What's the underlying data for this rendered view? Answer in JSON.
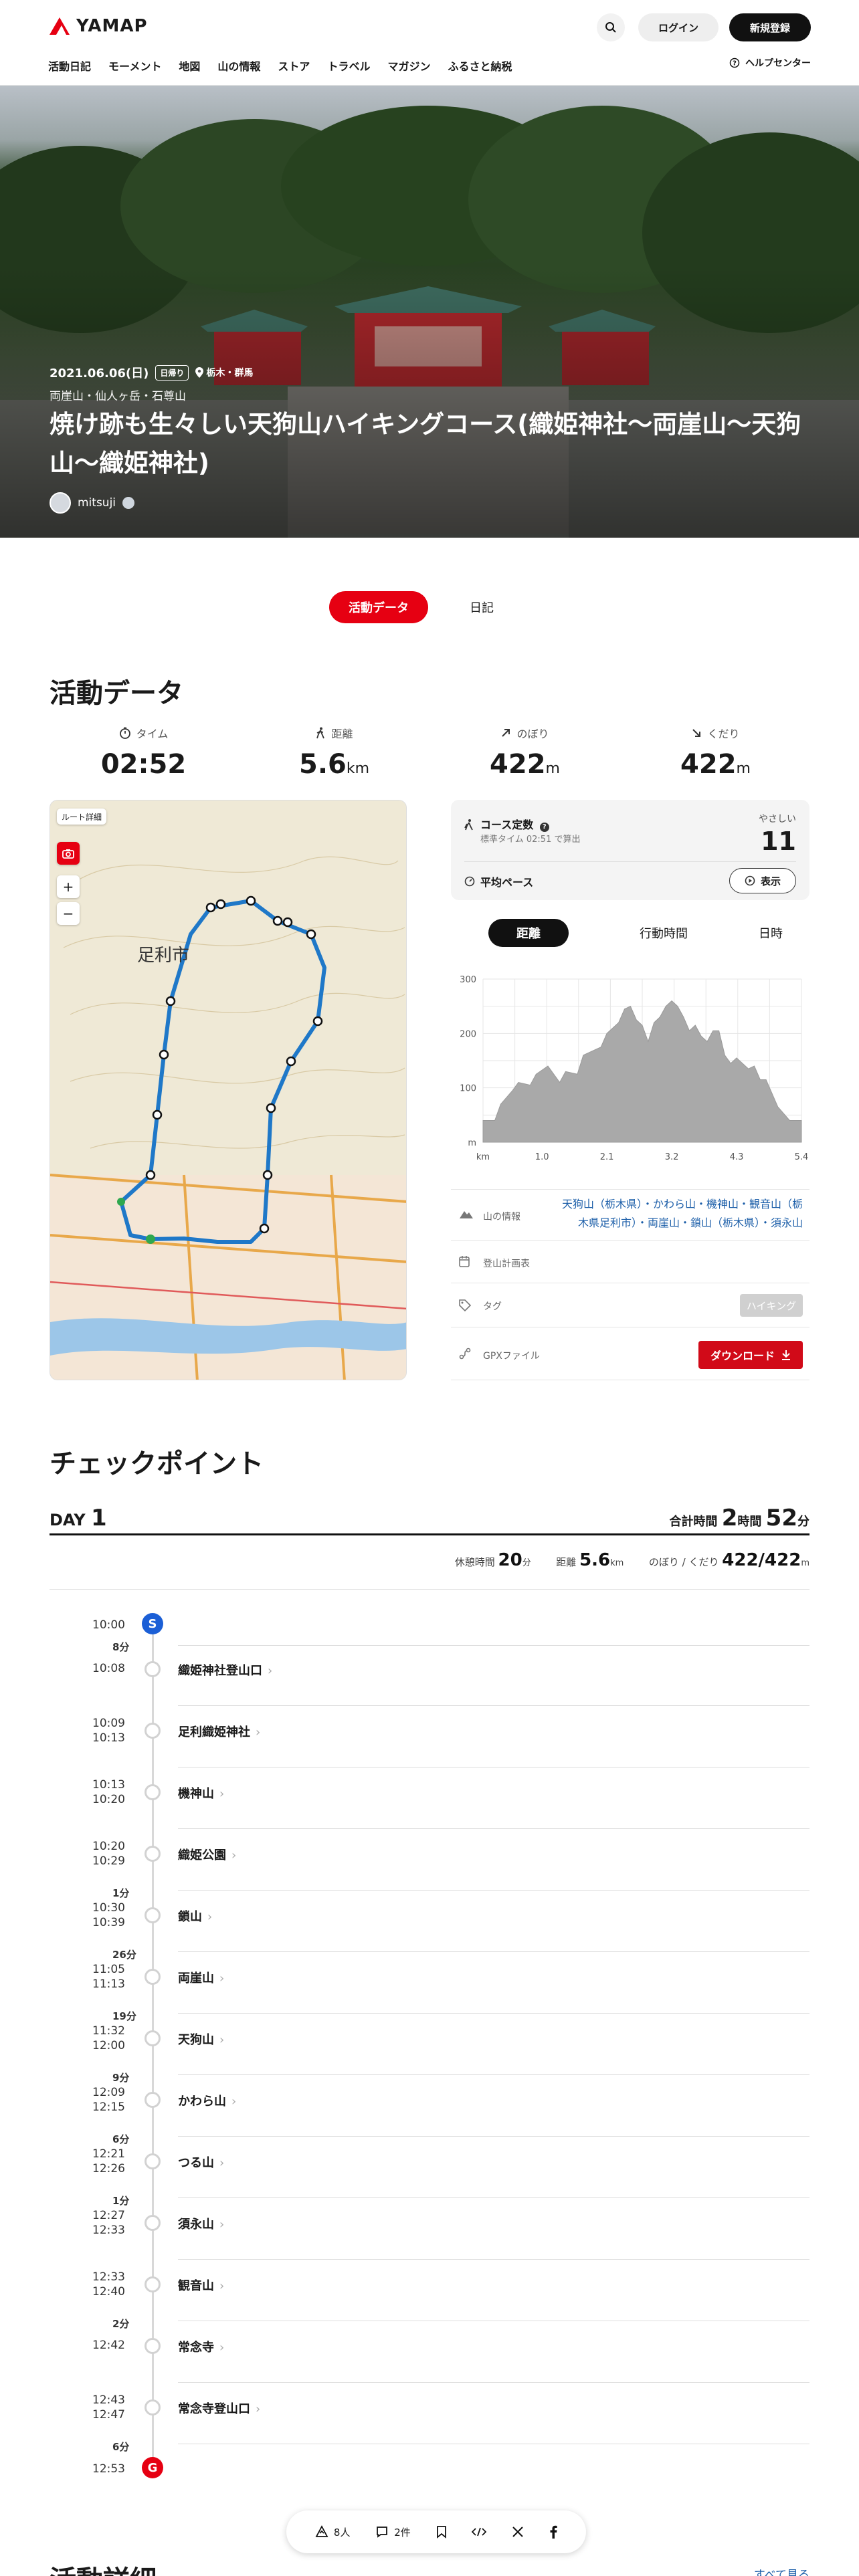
{
  "brand": {
    "name": "YAMAP",
    "accent": "#e60012"
  },
  "header": {
    "login": "ログイン",
    "signup": "新規登録",
    "nav": [
      "活動日記",
      "モーメント",
      "地図",
      "山の情報",
      "ストア",
      "トラベル",
      "マガジン",
      "ふるさと納税"
    ],
    "help": "ヘルプセンター"
  },
  "hero": {
    "date": "2021.06.06(日)",
    "badge": "日帰り",
    "location": "栃木・群馬",
    "mountains": "両崖山・仙人ヶ岳・石尊山",
    "title": "焼け跡も生々しい天狗山ハイキングコース(織姫神社〜両崖山〜天狗山〜織姫神社)",
    "user": "mitsuji"
  },
  "tabs": {
    "active": "活動データ",
    "other": "日記"
  },
  "activity": {
    "title": "活動データ",
    "stats": [
      {
        "label": "タイム",
        "value": "02:52",
        "unit": "",
        "icon": "clock-icon"
      },
      {
        "label": "距離",
        "value": "5.6",
        "unit": "km",
        "icon": "walker-icon"
      },
      {
        "label": "のぼり",
        "value": "422",
        "unit": "m",
        "icon": "arrow-up-right-icon"
      },
      {
        "label": "くだり",
        "value": "422",
        "unit": "m",
        "icon": "arrow-down-right-icon"
      }
    ],
    "map": {
      "route_detail": "ルート詳細",
      "city_label": "足利市",
      "plus": "+",
      "minus": "−"
    },
    "course": {
      "title": "コース定数",
      "sub": "標準タイム 02:51 で算出",
      "level": "やさしい",
      "value": "11",
      "pace": "平均ペース",
      "show": "表示"
    },
    "segments": [
      "距離",
      "行動時間",
      "日時"
    ],
    "info": {
      "mountain_label": "山の情報",
      "mountains": "天狗山（栃木県）・かわら山・機神山・観音山（栃木県足利市）・両崖山・鎖山（栃木県）・須永山",
      "plan_label": "登山計画表",
      "tag_label": "タグ",
      "tag_value": "ハイキング",
      "gpx_label": "GPXファイル",
      "download": "ダウンロード"
    }
  },
  "chart_data": {
    "type": "area",
    "x": [
      0,
      0.2,
      0.3,
      0.5,
      0.6,
      0.8,
      0.9,
      1.1,
      1.3,
      1.4,
      1.6,
      1.7,
      1.9,
      2.0,
      2.1,
      2.3,
      2.4,
      2.5,
      2.6,
      2.7,
      2.8,
      2.9,
      3.0,
      3.1,
      3.2,
      3.3,
      3.4,
      3.5,
      3.6,
      3.7,
      3.8,
      3.9,
      4.0,
      4.1,
      4.2,
      4.3,
      4.4,
      4.5,
      4.6,
      4.7,
      4.8,
      4.9,
      5.0,
      5.2,
      5.4
    ],
    "y": [
      40,
      40,
      70,
      95,
      110,
      105,
      125,
      140,
      110,
      130,
      125,
      160,
      170,
      175,
      200,
      220,
      245,
      250,
      225,
      215,
      185,
      220,
      230,
      250,
      260,
      250,
      230,
      205,
      215,
      195,
      185,
      205,
      205,
      160,
      145,
      155,
      145,
      135,
      140,
      115,
      115,
      90,
      65,
      40,
      40
    ],
    "xlabel": "km",
    "ylabel": "m",
    "xticks": [
      "1.0",
      "2.1",
      "3.2",
      "4.3",
      "5.4"
    ],
    "yticks": [
      "300",
      "200",
      "100"
    ],
    "xlim": [
      0,
      5.4
    ],
    "ylim": [
      0,
      300
    ],
    "grid": true,
    "fill": "#a9a9a9"
  },
  "checkpoints": {
    "title": "チェックポイント",
    "day_label": "DAY",
    "day_num": "1",
    "total_label": "合計時間",
    "total_h": "2",
    "total_h_unit": "時間",
    "total_m": "52",
    "total_m_unit": "分",
    "rest_label": "休憩時間",
    "rest_value": "20",
    "rest_unit": "分",
    "dist_label": "距離",
    "dist_value": "5.6",
    "dist_unit": "km",
    "updown_label": "のぼり / くだり",
    "up_value": "422",
    "down_value": "422",
    "updown_unit": "m",
    "start_time": "10:00",
    "start_symbol": "S",
    "goal_time": "12:53",
    "goal_symbol": "G",
    "items": [
      {
        "gap": "8分",
        "times": [
          "10:08"
        ],
        "name": "織姫神社登山口"
      },
      {
        "gap": "",
        "times": [
          "10:09",
          "10:13"
        ],
        "name": "足利織姫神社"
      },
      {
        "gap": "",
        "times": [
          "10:13",
          "10:20"
        ],
        "name": "機神山"
      },
      {
        "gap": "",
        "times": [
          "10:20",
          "10:29"
        ],
        "name": "織姫公園"
      },
      {
        "gap": "1分",
        "times": [
          "10:30",
          "10:39"
        ],
        "name": "鎖山"
      },
      {
        "gap": "26分",
        "times": [
          "11:05",
          "11:13"
        ],
        "name": "両崖山"
      },
      {
        "gap": "19分",
        "times": [
          "11:32",
          "12:00"
        ],
        "name": "天狗山"
      },
      {
        "gap": "9分",
        "times": [
          "12:09",
          "12:15"
        ],
        "name": "かわら山"
      },
      {
        "gap": "6分",
        "times": [
          "12:21",
          "12:26"
        ],
        "name": "つる山"
      },
      {
        "gap": "1分",
        "times": [
          "12:27",
          "12:33"
        ],
        "name": "須永山"
      },
      {
        "gap": "",
        "times": [
          "12:33",
          "12:40"
        ],
        "name": "観音山"
      },
      {
        "gap": "2分",
        "times": [
          "12:42"
        ],
        "name": "常念寺"
      },
      {
        "gap": "",
        "times": [
          "12:43",
          "12:47"
        ],
        "name": "常念寺登山口"
      }
    ],
    "final_gap": "6分"
  },
  "sharebar": {
    "likes": "8人",
    "comments": "2件"
  },
  "bottom": {
    "title": "活動詳細",
    "see_all": "すべて見る"
  }
}
